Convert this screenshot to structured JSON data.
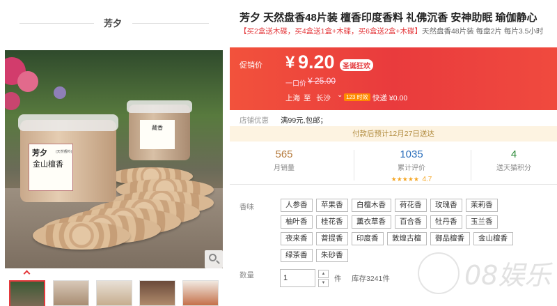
{
  "shop": {
    "name": "芳夕"
  },
  "product": {
    "title": "芳夕 天然盘香48片装 檀香印度香料 礼佛沉香 安神助眠 瑜伽静心",
    "promo_highlight": "【买2盒送木碟，买4盒送1盒+木碟，买6盒送2盒+木碟】",
    "promo_rest": "天然盘香48片装 每盘2片 每片3.5小时",
    "photo_label_brand": "芳夕",
    "photo_label_sub": "(天然香料)",
    "photo_label_product": "金山檀香",
    "photo_label2": "藏香"
  },
  "price": {
    "label": "促销价",
    "currency": "¥",
    "value": "9.20",
    "badge": "圣诞狂欢",
    "original_label": "一口价",
    "original_value": "¥ 25.00"
  },
  "shipping": {
    "from": "上海",
    "to_word": "至",
    "city": "长沙",
    "chevron": "⌄",
    "hour_badge": "123 时效",
    "fee": "快递 ¥0.00"
  },
  "shop_benefit": {
    "label": "店铺优惠",
    "text": "满99元,包邮；"
  },
  "notice": "付款后预计12月27日送达",
  "stats": [
    {
      "value": "565",
      "label": "月销量",
      "color": "#b57a3c"
    },
    {
      "value": "1035",
      "label": "累计评价",
      "color": "#2a6ebb",
      "stars": "★★★★★",
      "rating": "4.7"
    },
    {
      "value": "4",
      "label": "送天猫积分",
      "color": "#2e8b3a"
    }
  ],
  "options": {
    "label": "香味",
    "items": [
      "人参香",
      "苹果香",
      "白檀木香",
      "荷花香",
      "玫瑰香",
      "茉莉香",
      "柚叶香",
      "桂花香",
      "薰衣草香",
      "百合香",
      "牡丹香",
      "玉兰香",
      "夜来香",
      "菩提香",
      "印度香",
      "敦煌古檀",
      "御品檀香",
      "金山檀香",
      "绿茶香",
      "朱砂香"
    ]
  },
  "quantity": {
    "label": "数量",
    "value": "1",
    "unit": "件",
    "stock": "库存3241件",
    "up": "▲",
    "down": "▼"
  },
  "watermark": {
    "text": "08娱乐"
  },
  "colors": {
    "accent": "#e4393c",
    "price_bg": "#ec4141",
    "notice_bg": "#fdf3e1"
  }
}
